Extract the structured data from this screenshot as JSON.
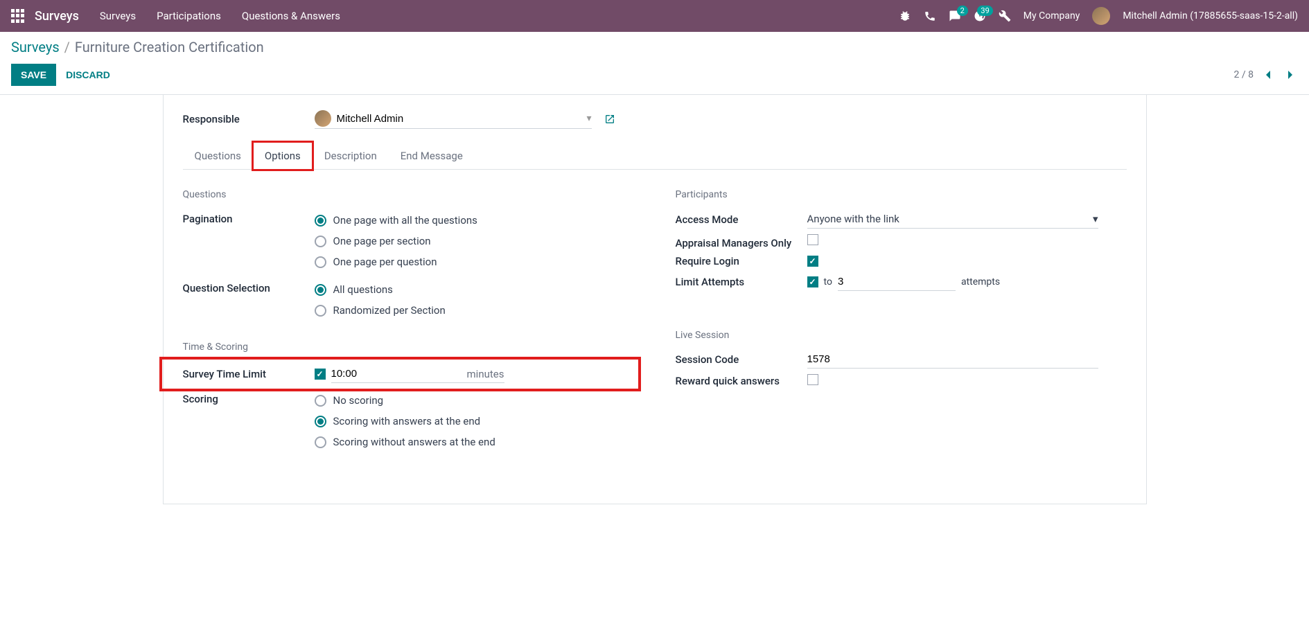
{
  "navbar": {
    "brand": "Surveys",
    "menu": [
      "Surveys",
      "Participations",
      "Questions & Answers"
    ],
    "chat_badge": "2",
    "activity_badge": "39",
    "company": "My Company",
    "user": "Mitchell Admin (17885655-saas-15-2-all)"
  },
  "breadcrumb": {
    "root": "Surveys",
    "current": "Furniture Creation Certification"
  },
  "actions": {
    "save": "SAVE",
    "discard": "DISCARD"
  },
  "pager": {
    "text": "2 / 8"
  },
  "form": {
    "responsible_label": "Responsible",
    "responsible_value": "Mitchell Admin"
  },
  "tabs": [
    "Questions",
    "Options",
    "Description",
    "End Message"
  ],
  "options": {
    "sections": {
      "questions_title": "Questions",
      "pagination_label": "Pagination",
      "pagination_options": [
        "One page with all the questions",
        "One page per section",
        "One page per question"
      ],
      "pagination_selected": 0,
      "question_selection_label": "Question Selection",
      "question_selection_options": [
        "All questions",
        "Randomized per Section"
      ],
      "question_selection_selected": 0,
      "participants_title": "Participants",
      "access_mode_label": "Access Mode",
      "access_mode_value": "Anyone with the link",
      "appraisal_label": "Appraisal Managers Only",
      "require_login_label": "Require Login",
      "limit_attempts_label": "Limit Attempts",
      "limit_attempts_prefix": "to",
      "limit_attempts_value": "3",
      "limit_attempts_suffix": "attempts",
      "time_scoring_title": "Time & Scoring",
      "time_limit_label": "Survey Time Limit",
      "time_limit_value": "10:00",
      "time_limit_unit": "minutes",
      "scoring_label": "Scoring",
      "scoring_options": [
        "No scoring",
        "Scoring with answers at the end",
        "Scoring without answers at the end"
      ],
      "scoring_selected": 1,
      "live_session_title": "Live Session",
      "session_code_label": "Session Code",
      "session_code_value": "1578",
      "reward_label": "Reward quick answers"
    }
  }
}
